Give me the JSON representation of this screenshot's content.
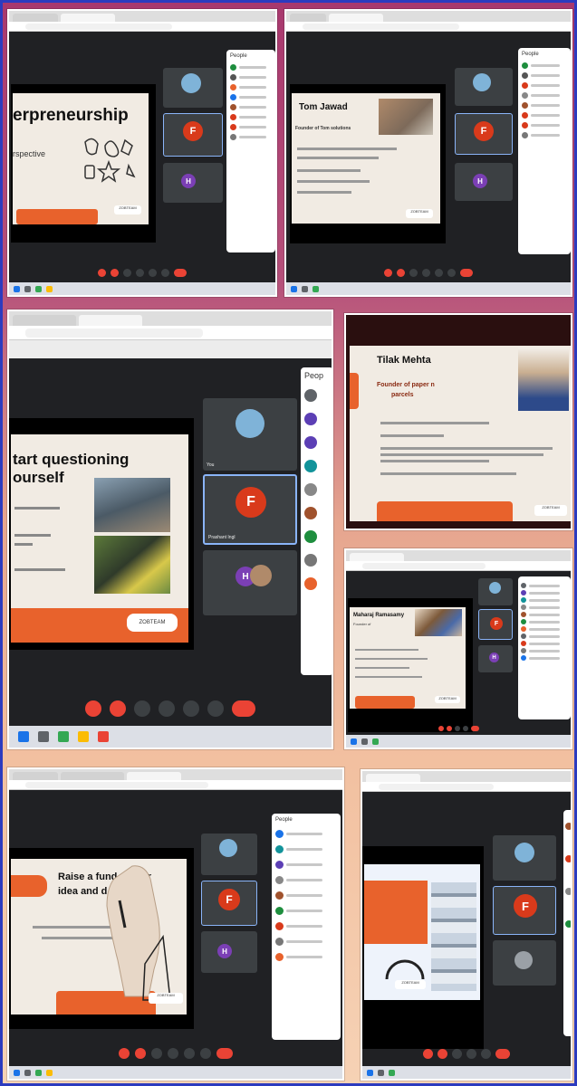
{
  "colors": {
    "meet_bg": "#202124",
    "tile_bg": "#3c4043",
    "accent_orange": "#e8622c",
    "end_call_red": "#ea4335",
    "avatar_f": "#d93a1b",
    "avatar_h": "#7b3fb5",
    "frame_border": "#2c3bbf"
  },
  "shots": [
    {
      "tabs": [
        "",
        ""
      ],
      "slide": {
        "title": "erpreneurship",
        "subtitle": "rspective"
      },
      "people_title": "People"
    },
    {
      "tabs": [
        "",
        ""
      ],
      "slide": {
        "title": "Tom Jawad",
        "subtitle": "Founder of Tom solutions"
      },
      "people_title": "People"
    },
    {
      "tabs": [
        "",
        ""
      ],
      "slide": {
        "title_line1": "tart questioning",
        "title_line2": "ourself"
      },
      "tiles": [
        {
          "name": "You"
        },
        {
          "name": "Prashant Ingl"
        },
        {
          "name": ""
        }
      ],
      "people_title": "Peop"
    },
    {
      "slide": {
        "title": "Tilak Mehta",
        "subtitle_line1": "Founder of paper n",
        "subtitle_line2": "parcels"
      }
    },
    {
      "tabs": [
        ""
      ],
      "slide": {
        "title": "Maharaj Ramasamy",
        "subtitle": "Founder of"
      },
      "people_title": ""
    },
    {
      "tabs": [
        "",
        "",
        ""
      ],
      "slide": {
        "title_line1": "Raise a fund",
        "title_line1b": "ur",
        "title_line2": "idea and d"
      },
      "people_title": "People"
    },
    {
      "tabs": [
        ""
      ],
      "slide": {
        "title": ""
      }
    }
  ],
  "avatar_letters": {
    "f": "F",
    "h": "H"
  },
  "watermark": "ZOBTEAM"
}
